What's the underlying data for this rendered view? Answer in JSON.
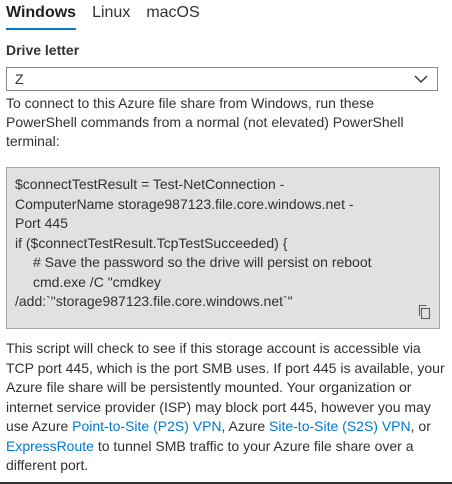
{
  "tabs": [
    {
      "label": "Windows",
      "active": true
    },
    {
      "label": "Linux",
      "active": false
    },
    {
      "label": "macOS",
      "active": false
    }
  ],
  "drive": {
    "label": "Drive letter",
    "value": "Z"
  },
  "intro_text": "To connect to this Azure file share from Windows, run these PowerShell commands from a normal (not elevated) PowerShell terminal:",
  "code": {
    "lines": [
      "$connectTestResult = Test-NetConnection -",
      "ComputerName storage987123.file.core.windows.net -",
      "Port 445",
      "if ($connectTestResult.TcpTestSucceeded) {",
      "# Save the password so the drive will persist on reboot",
      "cmd.exe /C \"cmdkey",
      "/add:`\"storage987123.file.core.windows.net`\""
    ]
  },
  "explanation": {
    "part1": "This script will check to see if this storage account is accessible via TCP port 445, which is the port SMB uses. If port 445 is available, your Azure file share will be persistently mounted. Your organization or internet service provider (ISP) may block port 445, however you may use Azure ",
    "link_p2s": "Point-to-Site (P2S) VPN",
    "part2": ", Azure ",
    "link_s2s": "Site-to-Site (S2S) VPN",
    "part3": ", or ",
    "link_expressroute": "ExpressRoute",
    "part4": " to tunnel SMB traffic to your Azure file share over a different port."
  },
  "icons": {
    "dropdown": "chevron-down-icon",
    "copy": "copy-icon"
  },
  "colors": {
    "accent": "#0078d4",
    "code_background": "#e1e1e1",
    "text": "#323130"
  }
}
